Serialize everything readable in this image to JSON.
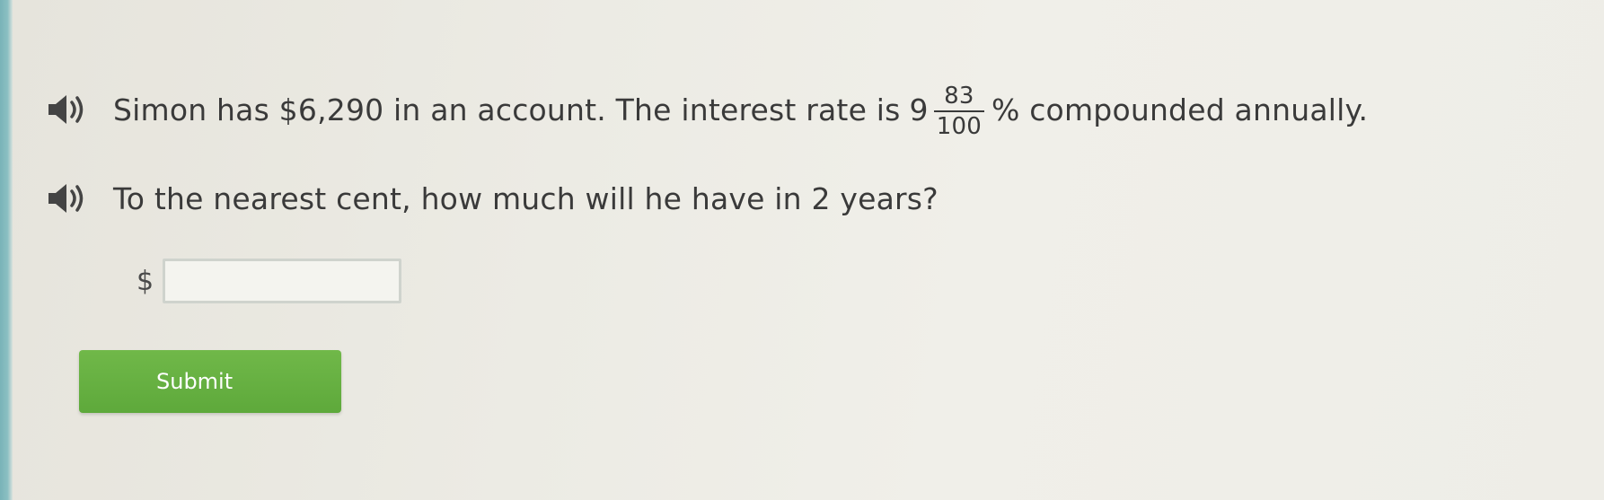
{
  "question": {
    "line1_before": "Simon has $6,290 in an account. The interest rate is",
    "rate_whole": "9",
    "rate_numerator": "83",
    "rate_denominator": "100",
    "line1_after": "% compounded annually.",
    "line2": "To the nearest cent, how much will he have in 2 years?"
  },
  "answer": {
    "currency_symbol": "$",
    "value": ""
  },
  "submit": {
    "label": "Submit",
    "color": "#66b043"
  },
  "icons": {
    "read_aloud": "speaker-icon"
  }
}
